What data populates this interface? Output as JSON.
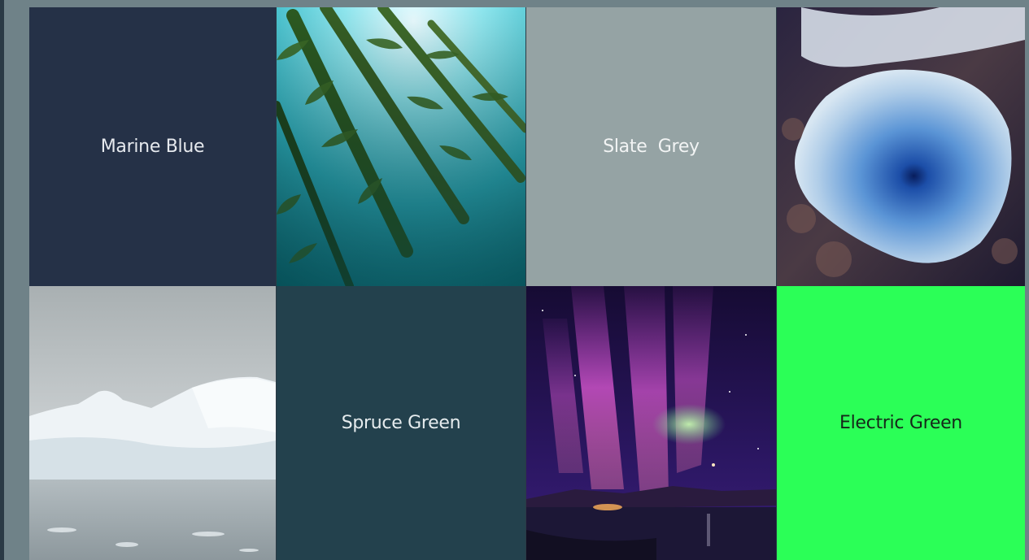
{
  "swatches": {
    "marine_blue": {
      "name": "Marine Blue",
      "color": "#253147",
      "text_color": "#e6e9ee"
    },
    "slate_grey": {
      "name": "Slate  Grey",
      "color": "#95a3a4",
      "text_color": "#f2f4f4"
    },
    "spruce_green": {
      "name": "Spruce Green",
      "color": "#23414d",
      "text_color": "#e6ecee"
    },
    "electric_green": {
      "name": "Electric Green",
      "color": "#2bff57",
      "text_color": "#16261a"
    }
  },
  "photos": {
    "kelp": {
      "icon": "kelp-forest-photo"
    },
    "ice_hole": {
      "icon": "ice-hole-photo"
    },
    "iceberg": {
      "icon": "iceberg-photo"
    },
    "aurora": {
      "icon": "aurora-photo"
    }
  },
  "colors": {
    "page_background": "#6f8288"
  }
}
